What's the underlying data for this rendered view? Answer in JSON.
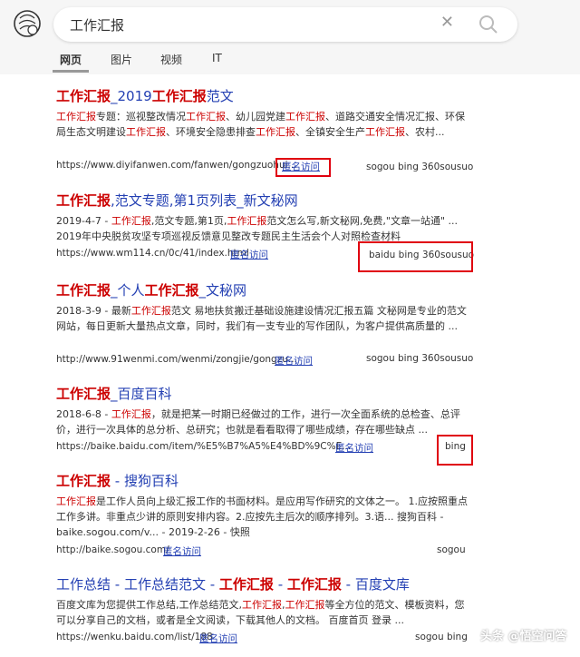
{
  "search": {
    "query": "工作汇报"
  },
  "tabs": [
    "网页",
    "图片",
    "视频",
    "IT"
  ],
  "results": [
    {
      "title_parts": [
        [
          "工作汇报",
          true
        ],
        [
          "_2019",
          false
        ],
        [
          "工作汇报",
          true
        ],
        [
          "范文",
          false
        ]
      ],
      "desc_parts": [
        [
          "工作汇报",
          true
        ],
        [
          "专题：巡视整改情况",
          false
        ],
        [
          "工作汇报",
          true
        ],
        [
          "、幼儿园党建",
          false
        ],
        [
          "工作汇报",
          true
        ],
        [
          "、道路交通安全情况汇报、环保局生态文明建设",
          false
        ],
        [
          "工作汇报",
          true
        ],
        [
          "、环境安全隐患排查",
          false
        ],
        [
          "工作汇报",
          true
        ],
        [
          "、全镇安全生产",
          false
        ],
        [
          "工作汇报",
          true
        ],
        [
          "、农村...",
          false
        ]
      ],
      "url": "https://www.diyifanwen.com/fanwen/gongzuohui...",
      "snapshot": "匿名访问",
      "engines": "sogou bing 360sousuo"
    },
    {
      "title_parts": [
        [
          "工作汇报",
          true
        ],
        [
          ",范文专题,第1页列表_新文秘网",
          false
        ]
      ],
      "desc_parts": [
        [
          "2019-4-7 - ",
          false
        ],
        [
          "工作汇报",
          true
        ],
        [
          ",范文专题,第1页,",
          false
        ],
        [
          "工作汇报",
          true
        ],
        [
          "范文怎么写,新文秘网,免费,\"文章一站通\" ... 2019年中央脱贫攻坚专项巡视反馈意见整改专题民主生活会个人对照检查材料",
          false
        ]
      ],
      "url": "https://www.wm114.cn/0c/41/index.html",
      "snapshot": "匿名访问",
      "engines": "baidu bing 360sousuo"
    },
    {
      "title_parts": [
        [
          "工作汇报",
          true
        ],
        [
          "_个人",
          false
        ],
        [
          "工作汇报",
          true
        ],
        [
          "_文秘网",
          false
        ]
      ],
      "desc_parts": [
        [
          "2018-3-9 - 最新",
          false
        ],
        [
          "工作汇报",
          true
        ],
        [
          "范文 易地扶贫搬迁基础设施建设情况汇报五篇 文秘网是专业的范文网站，每日更新大量热点文章，同时，我们有一支专业的写作团队，为客户提供高质量的 ...",
          false
        ]
      ],
      "url": "http://www.91wenmi.com/wenmi/zongjie/gongzu...",
      "snapshot": "匿名访问",
      "engines": "sogou bing 360sousuo"
    },
    {
      "title_parts": [
        [
          "工作汇报",
          true
        ],
        [
          "_百度百科",
          false
        ]
      ],
      "desc_parts": [
        [
          "2018-6-8 - ",
          false
        ],
        [
          "工作汇报",
          true
        ],
        [
          "，就是把某一时期已经做过的工作，进行一次全面系统的总检查、总评价，进行一次具体的总分析、总研究；也就是看看取得了哪些成绩，存在哪些缺点 ...",
          false
        ]
      ],
      "url": "https://baike.baidu.com/item/%E5%B7%A5%E4%BD%9C%E...",
      "snapshot": "匿名访问",
      "engines": "bing"
    },
    {
      "title_parts": [
        [
          "工作汇报",
          true
        ],
        [
          " - 搜狗百科",
          false
        ]
      ],
      "desc_parts": [
        [
          "工作汇报",
          true
        ],
        [
          "是工作人员向上级汇报工作的书面材料。是应用写作研究的文体之一。 1.应按照重点工作多讲。非重点少讲的原则安排内容。2.应按先主后次的顺序排列。3.语... 搜狗百科 - baike.sogou.com/v... - 2019-2-26 - 快照",
          false
        ]
      ],
      "url": "http://baike.sogou.com/",
      "snapshot": "匿名访问",
      "engines": "sogou"
    },
    {
      "title_parts": [
        [
          "工作总结 - 工作总结范文 - ",
          false
        ],
        [
          "工作汇报",
          true
        ],
        [
          " - ",
          false
        ],
        [
          "工作汇报",
          true
        ],
        [
          " - 百度文库",
          false
        ]
      ],
      "desc_parts": [
        [
          "百度文库为您提供工作总结,工作总结范文,",
          false
        ],
        [
          "工作汇报",
          true
        ],
        [
          ",",
          false
        ],
        [
          "工作汇报",
          true
        ],
        [
          "等全方位的范文、模板资料，您可以分享自己的文档，或者是全文阅读，下载其他人的文档。 百度首页 登录 ...",
          false
        ]
      ],
      "url": "https://wenku.baidu.com/list/188",
      "snapshot": "匿名访问",
      "engines": "sogou bing"
    }
  ],
  "watermark": "头条 @悟空问答",
  "colors": {
    "highlight": "#cc0000",
    "link": "#2440b3",
    "box": "#e0000f"
  }
}
